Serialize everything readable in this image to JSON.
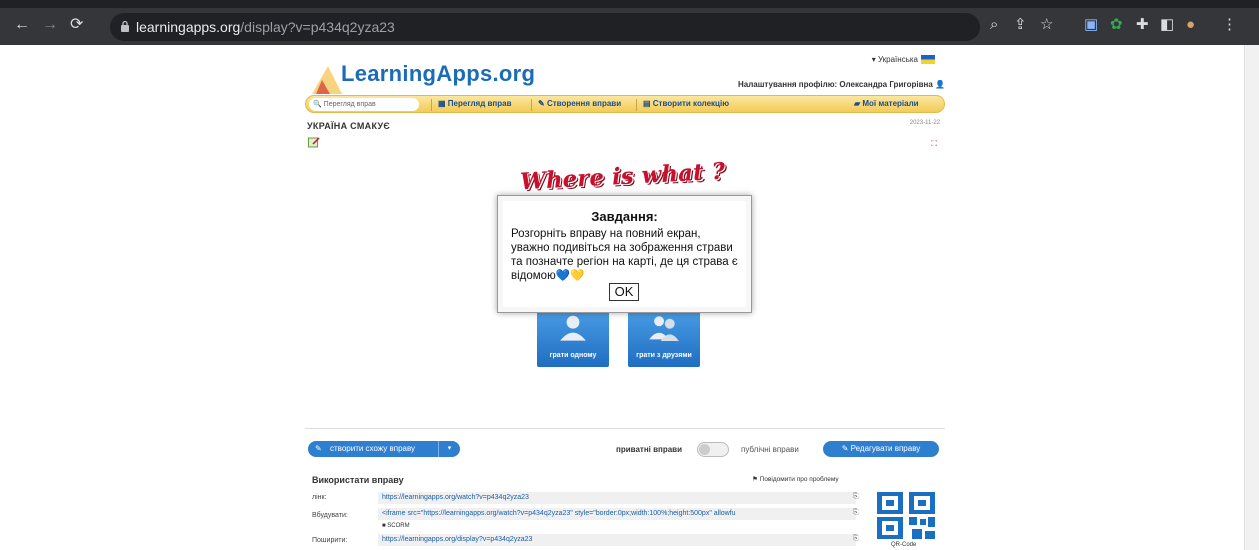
{
  "browser": {
    "url_host": "learningapps.org",
    "url_path": "/display?v=p434q2yza23"
  },
  "site": {
    "logo": "LearningApps.org",
    "language": "Українська",
    "profile": "Налаштування профілю: Олександра Григорівна",
    "search_placeholder": "Перегляд вправ",
    "nav": {
      "browse": "Перегляд вправ",
      "create": "Створення вправи",
      "collection": "Створити колекцію",
      "my": "Мої матеріали"
    }
  },
  "app": {
    "title": "УКРАЇНА СМАКУЄ",
    "date": "2023-11-22",
    "banner": "Where is what ?",
    "play_single": "грати одному",
    "play_friends": "грати з друзями"
  },
  "dialog": {
    "title": "Завдання:",
    "body": "Розгорніть вправу на повний екран, уважно подивіться на зображення страви та позначте регіон на карті, де ця страва є відомою",
    "hearts": "💙💛",
    "ok": "OK"
  },
  "actions": {
    "similar": "створити схожу вправу",
    "private": "приватні вправи",
    "public": "публічні вправи",
    "edit": "Редагувати вправу"
  },
  "use": {
    "title": "Використати вправу",
    "report": "Повідомити про проблему",
    "link_label": "лінк:",
    "link_value": "https://learningapps.org/watch?v=p434q2yza23",
    "embed_label": "Вбудувати:",
    "embed_value": "<iframe src=\"https://learningapps.org/watch?v=p434q2yza23\" style=\"border:0px;width:100%;height:500px\" allowfu",
    "scorm": "SCORM",
    "share_label": "Поширити:",
    "share_value": "https://learningapps.org/display?v=p434q2yza23",
    "qr_label": "QR-Code"
  }
}
